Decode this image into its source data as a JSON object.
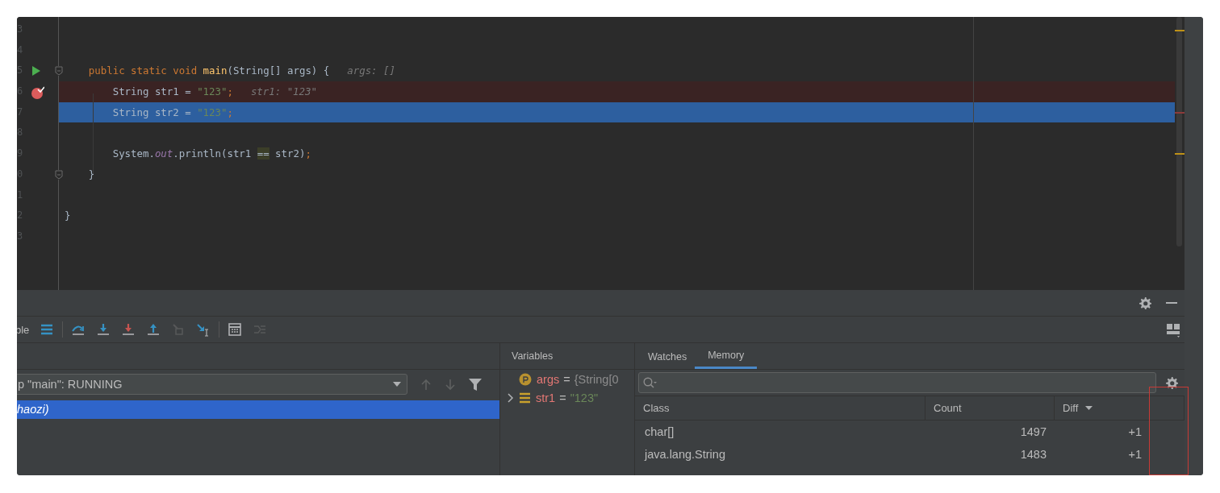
{
  "editor": {
    "lines": [
      {
        "number": "3",
        "run": false,
        "breakpoint": false,
        "fold": false,
        "current": false
      },
      {
        "number": "4",
        "run": false,
        "breakpoint": false,
        "fold": false,
        "current": false
      },
      {
        "number": "5",
        "run": true,
        "breakpoint": false,
        "fold": true,
        "current": false,
        "tokens": [
          {
            "kind": "keyword",
            "text": "    public static void "
          },
          {
            "kind": "method",
            "text": "main"
          },
          {
            "kind": "plain",
            "text": "(String[] args) {"
          }
        ],
        "hint": "args: []"
      },
      {
        "number": "6",
        "run": false,
        "breakpoint": true,
        "fold": false,
        "current": false,
        "tokens": [
          {
            "kind": "plain",
            "text": "        String str1 = "
          },
          {
            "kind": "string",
            "text": "\"123\""
          },
          {
            "kind": "punct",
            "text": ";"
          }
        ],
        "hint": "str1: \"123\""
      },
      {
        "number": "7",
        "run": false,
        "breakpoint": false,
        "fold": false,
        "current": true,
        "tokens": [
          {
            "kind": "plain",
            "text": "        String str2 = "
          },
          {
            "kind": "string",
            "text": "\"123\""
          },
          {
            "kind": "punct",
            "text": ";"
          }
        ]
      },
      {
        "number": "8",
        "run": false,
        "breakpoint": false,
        "fold": false,
        "current": false
      },
      {
        "number": "9",
        "run": false,
        "breakpoint": false,
        "fold": false,
        "current": false,
        "tokens": [
          {
            "kind": "plain",
            "text": "        System."
          },
          {
            "kind": "static",
            "text": "out"
          },
          {
            "kind": "plain",
            "text": ".println(str1 "
          },
          {
            "kind": "match",
            "text": "=="
          },
          {
            "kind": "plain",
            "text": " str2)"
          },
          {
            "kind": "punct",
            "text": ";"
          }
        ]
      },
      {
        "number": "0",
        "run": false,
        "breakpoint": false,
        "fold": true,
        "current": false,
        "tokens": [
          {
            "kind": "plain",
            "text": "    }"
          }
        ]
      },
      {
        "number": "1",
        "run": false,
        "breakpoint": false,
        "fold": false,
        "current": false
      },
      {
        "number": "2",
        "run": false,
        "breakpoint": false,
        "fold": false,
        "current": false,
        "tokens": [
          {
            "kind": "plain",
            "text": "}"
          }
        ]
      },
      {
        "number": "3",
        "run": false,
        "breakpoint": false,
        "fold": false,
        "current": false
      }
    ]
  },
  "toolbar": {
    "label": "ble",
    "buttons": [
      {
        "kind": "frames",
        "disabled": false
      },
      {
        "kind": "step-over",
        "disabled": false
      },
      {
        "kind": "step-into",
        "disabled": false
      },
      {
        "kind": "force-step-into",
        "disabled": false
      },
      {
        "kind": "step-out",
        "disabled": false
      },
      {
        "kind": "drop-frame",
        "disabled": true
      },
      {
        "kind": "run-to-cursor",
        "disabled": false
      },
      {
        "kind": "evaluate",
        "disabled": false
      },
      {
        "kind": "trace",
        "disabled": true
      }
    ]
  },
  "frames": {
    "thread": "p \"main\": RUNNING",
    "items": [
      {
        "text": "haozi)",
        "selected": true
      }
    ]
  },
  "variables": {
    "title": "Variables",
    "items": [
      {
        "kind": "param",
        "name": "args",
        "operator": "=",
        "value": "{String[0",
        "string_value": false,
        "expandable": false
      },
      {
        "kind": "field",
        "name": "str1",
        "operator": "=",
        "value": "\"123\"",
        "string_value": true,
        "expandable": true
      }
    ]
  },
  "memory": {
    "tabs": [
      {
        "label": "Watches",
        "selected": false
      },
      {
        "label": "Memory",
        "selected": true
      }
    ],
    "columns": [
      "Class",
      "Count",
      "Diff"
    ],
    "rows": [
      {
        "class": "char[]",
        "count": "1497",
        "diff": "+1"
      },
      {
        "class": "java.lang.String",
        "count": "1483",
        "diff": "+1"
      }
    ]
  }
}
